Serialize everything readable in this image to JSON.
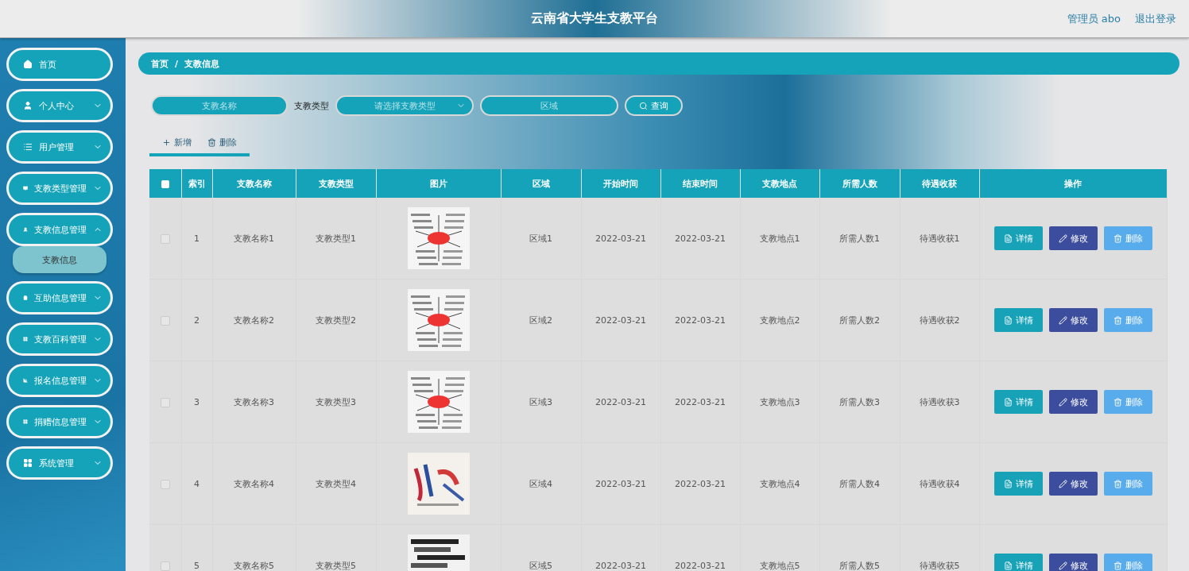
{
  "header": {
    "title": "云南省大学生支教平台",
    "user": "管理员 abo",
    "logout": "退出登录"
  },
  "sidebar": {
    "items": [
      {
        "label": "首页"
      },
      {
        "label": "个人中心",
        "expanded": false
      },
      {
        "label": "用户管理",
        "expanded": false
      },
      {
        "label": "支教类型管理",
        "expanded": false
      },
      {
        "label": "支教信息管理",
        "expanded": true,
        "children": [
          {
            "label": "支教信息",
            "selected": true
          }
        ]
      },
      {
        "label": "互助信息管理",
        "expanded": false
      },
      {
        "label": "支教百科管理",
        "expanded": false
      },
      {
        "label": "报名信息管理",
        "expanded": false
      },
      {
        "label": "捐赠信息管理",
        "expanded": false
      },
      {
        "label": "系统管理",
        "expanded": false
      }
    ]
  },
  "breadcrumb": {
    "items": [
      "首页",
      "支教信息"
    ],
    "separator": "/"
  },
  "search": {
    "name_placeholder": "支教名称",
    "type_label": "支教类型",
    "type_placeholder": "请选择支教类型",
    "region_placeholder": "区域",
    "button": "查询"
  },
  "actions": {
    "add": "新增",
    "delete": "删除"
  },
  "table": {
    "columns": [
      "索引",
      "支教名称",
      "支教类型",
      "图片",
      "区域",
      "开始时间",
      "结束时间",
      "支教地点",
      "所需人数",
      "待遇收获",
      "操作"
    ],
    "all_checked": false,
    "rows": [
      {
        "checked": false,
        "index": "1",
        "name": "支教名称1",
        "type": "支教类型1",
        "region": "区域1",
        "start": "2022-03-21",
        "end": "2022-03-21",
        "place": "支教地点1",
        "people": "所需人数1",
        "benefit": "待遇收获1",
        "buttons": [
          "详情",
          "修改",
          "删除"
        ]
      },
      {
        "checked": false,
        "index": "2",
        "name": "支教名称2",
        "type": "支教类型2",
        "region": "区域2",
        "start": "2022-03-21",
        "end": "2022-03-21",
        "place": "支教地点2",
        "people": "所需人数2",
        "benefit": "待遇收获2",
        "buttons": [
          "详情",
          "修改",
          "删除"
        ]
      },
      {
        "checked": false,
        "index": "3",
        "name": "支教名称3",
        "type": "支教类型3",
        "region": "区域3",
        "start": "2022-03-21",
        "end": "2022-03-21",
        "place": "支教地点3",
        "people": "所需人数3",
        "benefit": "待遇收获3",
        "buttons": [
          "详情",
          "修改",
          "删除"
        ]
      },
      {
        "checked": false,
        "index": "4",
        "name": "支教名称4",
        "type": "支教类型4",
        "region": "区域4",
        "start": "2022-03-21",
        "end": "2022-03-21",
        "place": "支教地点4",
        "people": "所需人数4",
        "benefit": "待遇收获4",
        "buttons": [
          "详情",
          "修改",
          "删除"
        ]
      },
      {
        "checked": false,
        "index": "5",
        "name": "支教名称5",
        "type": "支教类型5",
        "region": "区域5",
        "start": "2022-03-21",
        "end": "2022-03-21",
        "place": "支教地点5",
        "people": "所需人数5",
        "benefit": "待遇收获5",
        "buttons": [
          "详情",
          "修改",
          "删除"
        ]
      }
    ]
  }
}
